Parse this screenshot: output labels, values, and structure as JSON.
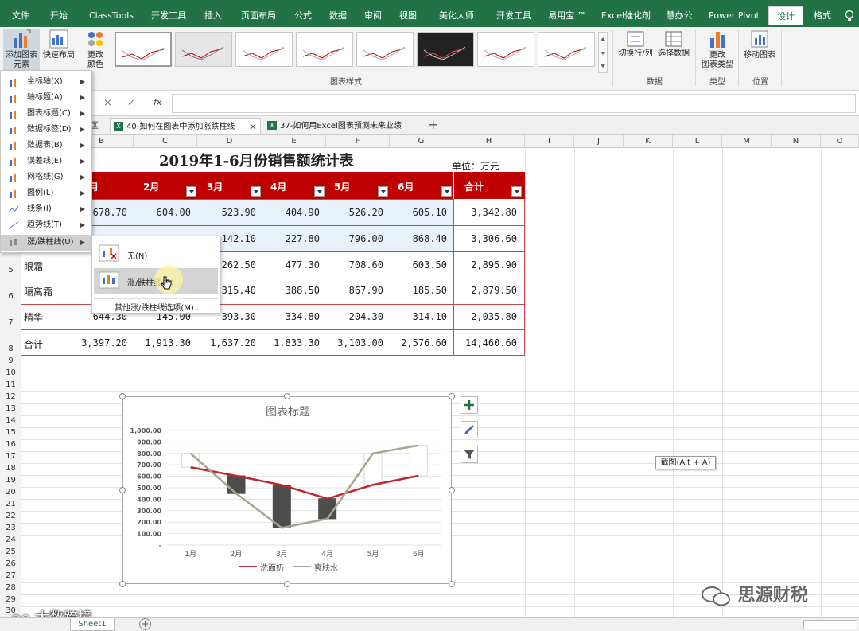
{
  "ribbon_tabs": [
    "文件",
    "开始",
    "ClassTools",
    "开发工具",
    "插入",
    "页面布局",
    "公式",
    "数据",
    "审阅",
    "视图",
    "美化大师",
    "开发工具",
    "易用宝 ™",
    "Excel催化剂",
    "慧办公",
    "Power Pivot",
    "设计",
    "格式"
  ],
  "active_tab": "设计",
  "ribbon": {
    "add_element_label_1": "添加图表",
    "add_element_label_2": "元素",
    "quick_layout": "快速布局",
    "change_color_1": "更改",
    "change_color_2": "颜色",
    "chart_styles_group": "图表样式",
    "switch_row_col": "切换行/列",
    "select_data": "选择数据",
    "data_group": "数据",
    "change_type_1": "更改",
    "change_type_2": "图表类型",
    "type_group": "类型",
    "move_chart": "移动图表",
    "location_group": "位置"
  },
  "formula_bar": {
    "cancel": "×",
    "enter": "✓",
    "fx": "fx"
  },
  "workbook_tabs": [
    "区",
    "40-如何在图表中添加涨跌柱线",
    "37-如何用Excel图表预测未来业绩"
  ],
  "columns": [
    "B",
    "C",
    "D",
    "E",
    "F",
    "G",
    "H",
    "I",
    "J",
    "K",
    "L",
    "M",
    "N",
    "O"
  ],
  "rows": [
    "5",
    "6",
    "7",
    "8",
    "9",
    "10",
    "11",
    "12",
    "13",
    "14",
    "15",
    "16",
    "17",
    "18",
    "19",
    "20",
    "21",
    "22",
    "23",
    "24",
    "25",
    "26",
    "27",
    "28",
    "29",
    "30"
  ],
  "sheet": {
    "title": "2019年1-6月份销售额统计表",
    "unit": "单位：万元",
    "headers": [
      "月",
      "2月",
      "3月",
      "4月",
      "5月",
      "6月",
      "合计"
    ],
    "row1": [
      "678.70",
      "604.00",
      "523.90",
      "404.90",
      "526.20",
      "605.10",
      "3,342.80"
    ],
    "row2": [
      "142.10",
      "227.80",
      "796.00",
      "868.40",
      "3,306.60"
    ],
    "row3_name": "眼霜",
    "row3": [
      "262.50",
      "477.30",
      "708.60",
      "603.50",
      "2,895.90"
    ],
    "row4_name": "隔离霜",
    "row4": [
      "315.40",
      "388.50",
      "867.90",
      "185.50",
      "2,879.50"
    ],
    "row5_name": "精华",
    "row5": [
      "644.30",
      "145.00",
      "393.30",
      "334.80",
      "204.30",
      "314.10",
      "2,035.80"
    ],
    "total_name": "合计",
    "totals": [
      "3,397.20",
      "1,913.30",
      "1,637.20",
      "1,833.30",
      "3,103.00",
      "2,576.60",
      "14,460.60"
    ]
  },
  "menu": {
    "items": [
      "坐标轴(X)",
      "轴标题(A)",
      "图表标题(C)",
      "数据标签(D)",
      "数据表(B)",
      "误差线(E)",
      "网格线(G)",
      "图例(L)",
      "线条(I)",
      "趋势线(T)",
      "涨/跌柱线(U)"
    ],
    "submenu": {
      "none": "无(N)",
      "updown": "涨/跌柱线(U)",
      "more": "其他涨/跌柱线选项(M)..."
    }
  },
  "chart_data": {
    "type": "line",
    "title": "图表标题",
    "categories": [
      "1月",
      "2月",
      "3月",
      "4月",
      "5月",
      "6月"
    ],
    "ylim": [
      0,
      1000
    ],
    "yticks": [
      "1,000.00",
      "900.00",
      "800.00",
      "700.00",
      "600.00",
      "500.00",
      "400.00",
      "300.00",
      "200.00",
      "100.00",
      "-"
    ],
    "series": [
      {
        "name": "洗面奶",
        "values": [
          678.7,
          604.0,
          523.9,
          404.9,
          526.2,
          605.1
        ],
        "color": "#c0262d"
      },
      {
        "name": "爽肤水",
        "values": [
          800,
          450,
          150,
          230,
          800,
          870
        ],
        "color": "#a9a38f"
      }
    ],
    "legend": "bottom",
    "grid": true,
    "up_down_bars": true
  },
  "tooltip": "截图(Alt + A)",
  "watermark_left": "大数跨境",
  "watermark_right": "思源财税",
  "sheet_tab": "Sheet1"
}
